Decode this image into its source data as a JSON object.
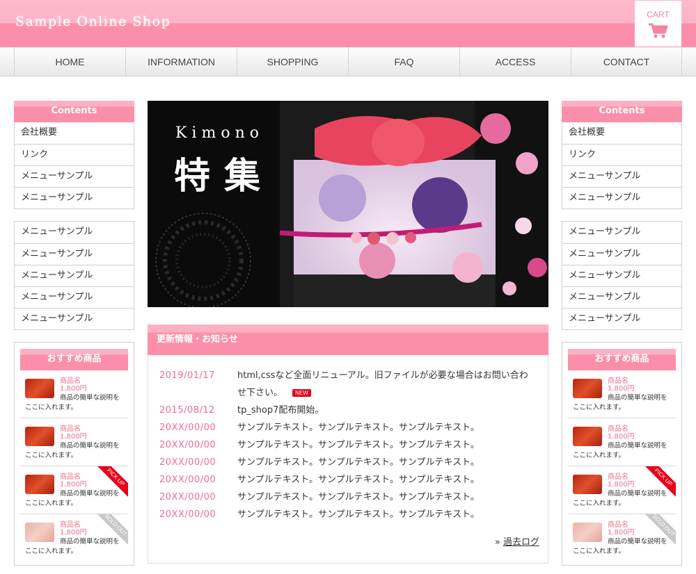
{
  "header": {
    "site_title": "Sample Online Shop",
    "cart_label": "CART",
    "cart_icon": "shopping-cart-icon",
    "accent_color": "#fb8fa9"
  },
  "nav": {
    "items": [
      "HOME",
      "INFORMATION",
      "SHOPPING",
      "FAQ",
      "ACCESS",
      "CONTACT"
    ]
  },
  "sidebar_left": {
    "contents_title": "Contents",
    "contents_items": [
      "会社概要",
      "リンク",
      "メニューサンプル",
      "メニューサンプル"
    ],
    "menu_items": [
      "メニューサンプル",
      "メニューサンプル",
      "メニューサンプル",
      "メニューサンプル",
      "メニューサンプル"
    ],
    "recommend_title": "おすすめ商品",
    "products": [
      {
        "name": "商品名",
        "price": "1,800円",
        "desc1": "商品の簡単な説明を",
        "desc2": "ここに入れます。",
        "ribbon": ""
      },
      {
        "name": "商品名",
        "price": "1,800円",
        "desc1": "商品の簡単な説明を",
        "desc2": "ここに入れます。",
        "ribbon": ""
      },
      {
        "name": "商品名",
        "price": "1,800円",
        "desc1": "商品の簡単な説明を",
        "desc2": "ここに入れます。",
        "ribbon": "PICK UP"
      },
      {
        "name": "商品名",
        "price": "1,800円",
        "desc1": "商品の簡単な説明を",
        "desc2": "ここに入れます。",
        "ribbon": "SOLD OUT"
      }
    ]
  },
  "sidebar_right": {
    "contents_title": "Contents",
    "contents_items": [
      "会社概要",
      "リンク",
      "メニューサンプル",
      "メニューサンプル"
    ],
    "menu_items": [
      "メニューサンプル",
      "メニューサンプル",
      "メニューサンプル",
      "メニューサンプル",
      "メニューサンプル"
    ],
    "recommend_title": "おすすめ商品",
    "products": [
      {
        "name": "商品名",
        "price": "1,800円",
        "desc1": "商品の簡単な説明を",
        "desc2": "ここに入れます。",
        "ribbon": ""
      },
      {
        "name": "商品名",
        "price": "1,800円",
        "desc1": "商品の簡単な説明を",
        "desc2": "ここに入れます。",
        "ribbon": ""
      },
      {
        "name": "商品名",
        "price": "1,800円",
        "desc1": "商品の簡単な説明を",
        "desc2": "ここに入れます。",
        "ribbon": "PICK UP"
      },
      {
        "name": "商品名",
        "price": "1,800円",
        "desc1": "商品の簡単な説明を",
        "desc2": "ここに入れます。",
        "ribbon": "SOLD OUT"
      }
    ]
  },
  "hero": {
    "title_en": "Kimono",
    "title_ja": "特集"
  },
  "news": {
    "title": "更新情報・お知らせ",
    "new_badge": "NEW",
    "rows": [
      {
        "date": "2019/01/17",
        "text": "html,cssなど全面リニューアル。旧ファイルが必要な場合はお問い合わせ下さい。"
      },
      {
        "date": "2015/08/12",
        "text": "tp_shop7配布開始。"
      },
      {
        "date": "20XX/00/00",
        "text": "サンプルテキスト。サンプルテキスト。サンプルテキスト。"
      },
      {
        "date": "20XX/00/00",
        "text": "サンプルテキスト。サンプルテキスト。サンプルテキスト。"
      },
      {
        "date": "20XX/00/00",
        "text": "サンプルテキスト。サンプルテキスト。サンプルテキスト。"
      },
      {
        "date": "20XX/00/00",
        "text": "サンプルテキスト。サンプルテキスト。サンプルテキスト。"
      },
      {
        "date": "20XX/00/00",
        "text": "サンプルテキスト。サンプルテキスト。サンプルテキスト。"
      },
      {
        "date": "20XX/00/00",
        "text": "サンプルテキスト。サンプルテキスト。サンプルテキスト。"
      }
    ],
    "archive_label": "過去ログ"
  }
}
